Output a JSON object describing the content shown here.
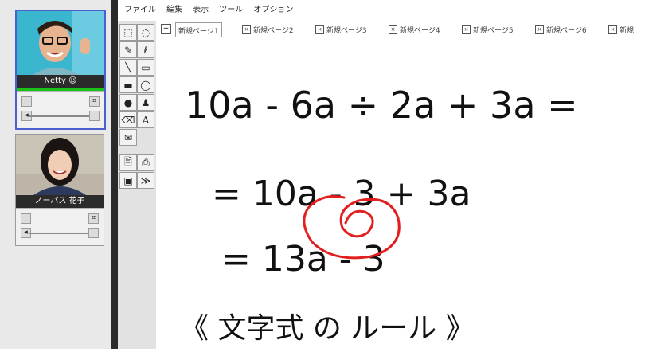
{
  "participants": [
    {
      "name": "Netty ☺"
    },
    {
      "name": "ノーバス 花子"
    }
  ],
  "menu": [
    "ファイル",
    "編集",
    "表示",
    "ツール",
    "オプション"
  ],
  "tabs": [
    "新規ページ1",
    "新規ページ2",
    "新規ページ3",
    "新規ページ4",
    "新規ページ5",
    "新規ページ6",
    "新規"
  ],
  "tools": {
    "text_tool": "A"
  },
  "whiteboard": {
    "line1": "10a - 6a ÷ 2a + 3a =",
    "line2": "= 10a - 3 + 3a",
    "line3": "= 13a - 3",
    "line4": "《 文字式 の ルール 》"
  },
  "colors": {
    "accent": "#4a5fd0",
    "ink": "#111111",
    "marker": "#e31e1e",
    "level": "#19c219"
  }
}
